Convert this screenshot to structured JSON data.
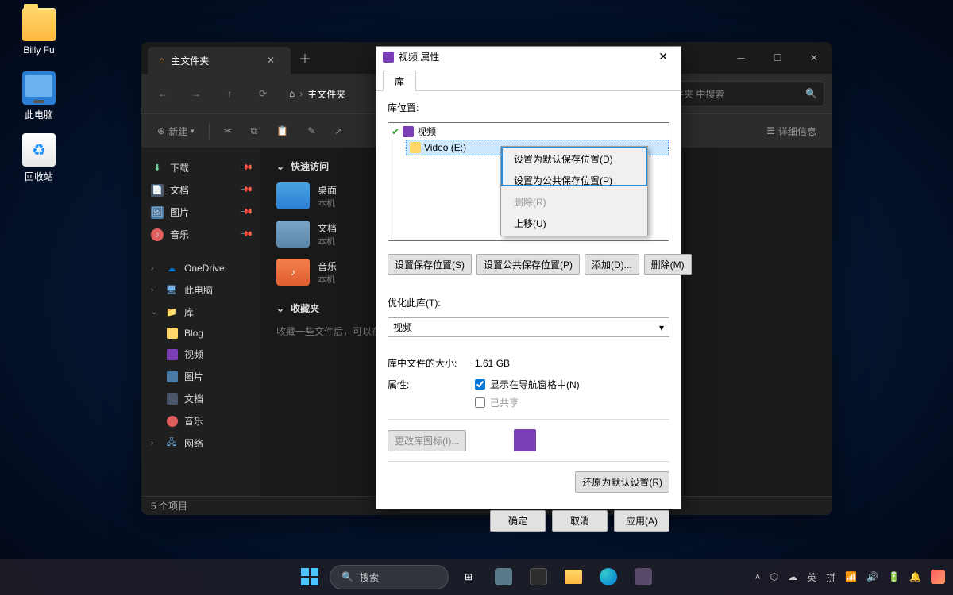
{
  "desktop": {
    "icons": [
      {
        "label": "Billy Fu"
      },
      {
        "label": "此电脑"
      },
      {
        "label": "回收站"
      }
    ]
  },
  "explorer": {
    "tab_title": "主文件夹",
    "breadcrumb_home": "主文件夹",
    "search_placeholder": "文件夹 中搜索",
    "toolbar": {
      "new": "新建",
      "details": "详细信息"
    },
    "sidebar": {
      "quick": [
        {
          "label": "下载"
        },
        {
          "label": "文档"
        },
        {
          "label": "图片"
        },
        {
          "label": "音乐"
        }
      ],
      "groups": [
        {
          "label": "OneDrive",
          "chev": "›"
        },
        {
          "label": "此电脑",
          "chev": "›"
        },
        {
          "label": "库",
          "chev": "⌄",
          "children": [
            {
              "label": "Blog"
            },
            {
              "label": "视频"
            },
            {
              "label": "图片"
            },
            {
              "label": "文档"
            },
            {
              "label": "音乐"
            }
          ]
        },
        {
          "label": "网络",
          "chev": "›"
        }
      ]
    },
    "content": {
      "quick_access": "快速访问",
      "folders": [
        {
          "name": "桌面",
          "sub": "本机"
        },
        {
          "name": "文档",
          "sub": "本机"
        },
        {
          "name": "音乐",
          "sub": "本机"
        }
      ],
      "favorites_header": "收藏夹",
      "favorites_empty": "收藏一些文件后，可以在此处查看它们。"
    },
    "status": "5 个项目"
  },
  "props": {
    "title": "视频 属性",
    "tab": "库",
    "location_label": "库位置:",
    "locations": [
      {
        "label": "视频",
        "indent": 0
      },
      {
        "label": "Video (E:)",
        "indent": 1,
        "selected": true
      }
    ],
    "buttons": {
      "set_save": "设置保存位置(S)",
      "set_public": "设置公共保存位置(P)",
      "add": "添加(D)...",
      "remove": "删除(M)"
    },
    "optimize_label": "优化此库(T):",
    "optimize_value": "视频",
    "size_label": "库中文件的大小:",
    "size_value": "1.61 GB",
    "attrs_label": "属性:",
    "show_nav": "显示在导航窗格中(N)",
    "shared": "已共享",
    "change_icon": "更改库图标(I)...",
    "restore": "还原为默认设置(R)",
    "ok": "确定",
    "cancel": "取消",
    "apply": "应用(A)"
  },
  "ctx": {
    "set_default": "设置为默认保存位置(D)",
    "set_public": "设置为公共保存位置(P)",
    "remove": "删除(R)",
    "move_up": "上移(U)"
  },
  "taskbar": {
    "search": "搜索",
    "tray": {
      "ime1": "英",
      "ime2": "拼"
    }
  }
}
